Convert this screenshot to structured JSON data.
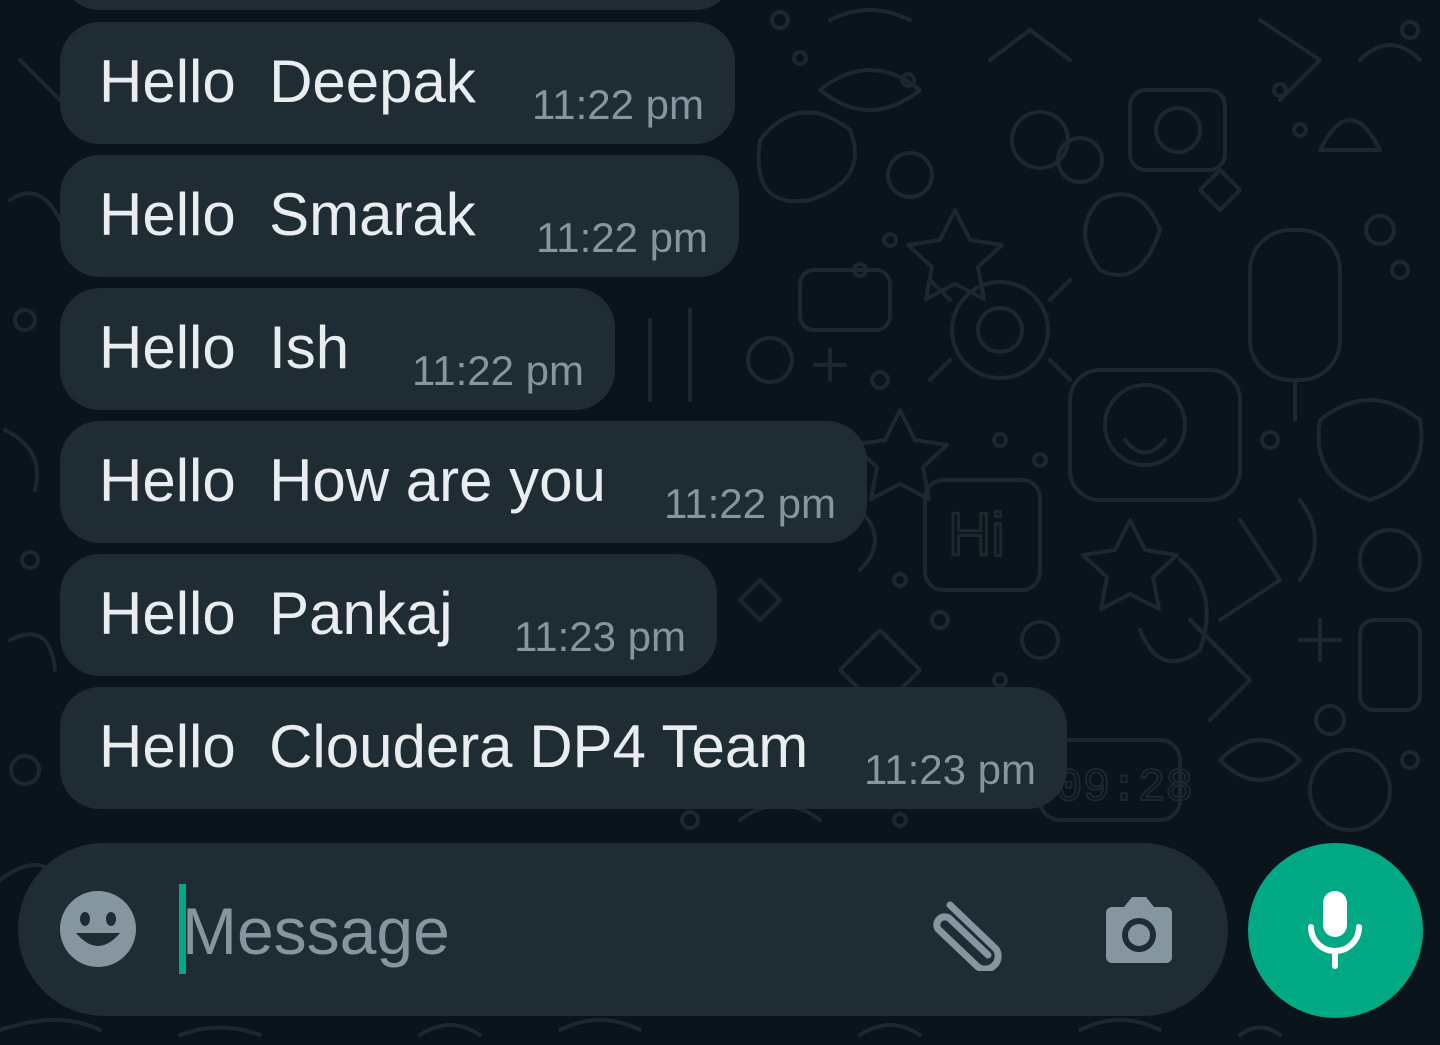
{
  "colors": {
    "chat_background": "#0b141a",
    "bubble": "#1f2c34",
    "message_text": "#e9edef",
    "timestamp_text": "#8696a0",
    "accent": "#00a884",
    "icon": "#8696a0"
  },
  "messages": [
    {
      "text": "Hello  Deepak",
      "time": "11:22 pm"
    },
    {
      "text": "Hello  Smarak",
      "time": "11:22 pm"
    },
    {
      "text": "Hello  Ish",
      "time": "11:22 pm"
    },
    {
      "text": "Hello  How are you",
      "time": "11:22 pm"
    },
    {
      "text": "Hello  Pankaj",
      "time": "11:23 pm"
    },
    {
      "text": "Hello  Cloudera DP4 Team",
      "time": "11:23 pm"
    }
  ],
  "composer": {
    "placeholder": "Message",
    "value": "",
    "emoji_icon": "emoji-smiley-icon",
    "attach_icon": "paperclip-icon",
    "camera_icon": "camera-icon"
  },
  "mic_button": {
    "icon": "microphone-icon"
  }
}
